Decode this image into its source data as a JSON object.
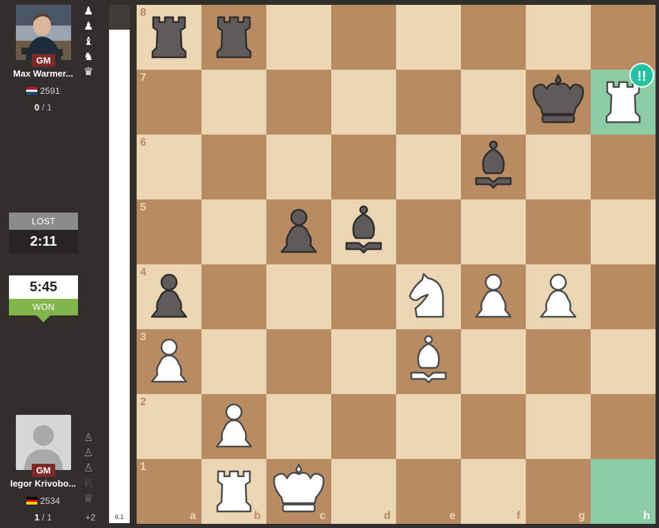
{
  "top_player": {
    "title": "GM",
    "name": "Max Warmer...",
    "rating": "2591",
    "flag": "netherlands-flag",
    "score_won": "0",
    "score_total": "1",
    "captured_icons": [
      "pawns-icon",
      "pawns-icon",
      "bishop-icon",
      "knight-icon",
      "queen-icon"
    ]
  },
  "top_clock": {
    "result": "LOST",
    "time": "2:11"
  },
  "bottom_clock": {
    "result": "WON",
    "time": "5:45"
  },
  "bottom_player": {
    "title": "GM",
    "name": "Iegor Krivobo...",
    "rating": "2534",
    "flag": "germany-flag",
    "score_won": "1",
    "score_total": "1",
    "material": "+2",
    "captured_icons": [
      "pawns-icon",
      "pawns-icon",
      "pawns-icon",
      "knights-icon",
      "queen-icon"
    ]
  },
  "eval": {
    "label": "6.1"
  },
  "board": {
    "light_color": "#ebd5b3",
    "dark_color": "#b88b62",
    "highlight_color": "#8bcca5",
    "files": [
      "a",
      "b",
      "c",
      "d",
      "e",
      "f",
      "g",
      "h"
    ],
    "ranks": [
      "8",
      "7",
      "6",
      "5",
      "4",
      "3",
      "2",
      "1"
    ],
    "highlighted_squares": [
      "h7",
      "h1"
    ],
    "move_badge": {
      "square": "h7",
      "text": "!!",
      "color": "#26c2a3"
    },
    "pieces": [
      {
        "square": "a8",
        "color": "black",
        "type": "rook"
      },
      {
        "square": "b8",
        "color": "black",
        "type": "rook"
      },
      {
        "square": "g7",
        "color": "black",
        "type": "king"
      },
      {
        "square": "h7",
        "color": "white",
        "type": "rook"
      },
      {
        "square": "f6",
        "color": "black",
        "type": "bishop"
      },
      {
        "square": "c5",
        "color": "black",
        "type": "pawn"
      },
      {
        "square": "d5",
        "color": "black",
        "type": "bishop"
      },
      {
        "square": "a4",
        "color": "black",
        "type": "pawn"
      },
      {
        "square": "e4",
        "color": "white",
        "type": "knight"
      },
      {
        "square": "f4",
        "color": "white",
        "type": "pawn"
      },
      {
        "square": "g4",
        "color": "white",
        "type": "pawn"
      },
      {
        "square": "a3",
        "color": "white",
        "type": "pawn"
      },
      {
        "square": "e3",
        "color": "white",
        "type": "bishop"
      },
      {
        "square": "b2",
        "color": "white",
        "type": "pawn"
      },
      {
        "square": "b1",
        "color": "white",
        "type": "rook"
      },
      {
        "square": "c1",
        "color": "white",
        "type": "king"
      }
    ]
  }
}
